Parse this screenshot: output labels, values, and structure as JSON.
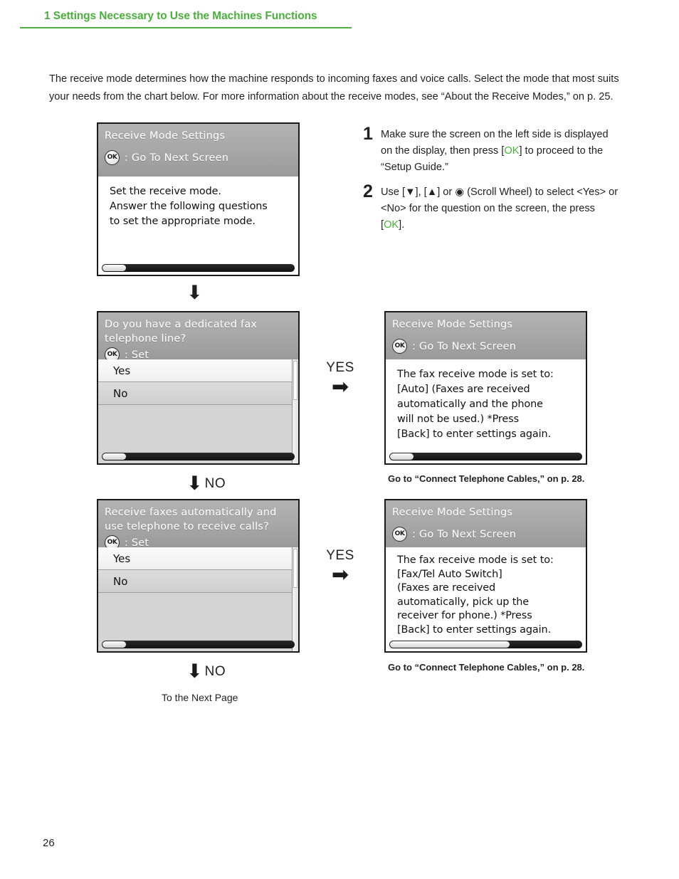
{
  "header": {
    "chapter_title": "1 Settings Necessary to Use the Machines Functions",
    "rule_color": "#4caf3f",
    "title_color": "#4caf3f"
  },
  "intro": {
    "paragraph": "The receive mode determines how the machine responds to incoming faxes and voice calls. Select the mode that most suits your needs from the chart below. For more information about the receive modes, see “About the Receive Modes,” on p. 25."
  },
  "screens": {
    "intro_screen": {
      "title": "Receive Mode Settings",
      "ok_icon": "ok-button-icon",
      "ok_label": ": Go To Next Screen",
      "body": "Set the receive mode.\nAnswer the following questions\nto set the appropriate mode.",
      "hscroll_percent": 12
    },
    "question_one": {
      "title": "Do you have a dedicated fax\ntelephone line?",
      "ok_icon": "ok-button-icon",
      "ok_label": ": Set",
      "options": [
        {
          "label": "Yes",
          "selected": true
        },
        {
          "label": "No",
          "selected": false
        }
      ],
      "hscroll_percent": 12
    },
    "result_auto": {
      "title": "Receive Mode Settings",
      "ok_icon": "ok-button-icon",
      "ok_label": ": Go To Next Screen",
      "body": "The fax receive mode is set to:\n[Auto] (Faxes are received\nautomatically and the phone\nwill not be used.) *Press\n[Back] to enter settings again.",
      "hscroll_percent": 12,
      "caption": "Go to “Connect Telephone Cables,” on p. 28."
    },
    "question_two": {
      "title": "Receive faxes automatically and\nuse telephone to receive calls?",
      "ok_icon": "ok-button-icon",
      "ok_label": ": Set",
      "options": [
        {
          "label": "Yes",
          "selected": true
        },
        {
          "label": "No",
          "selected": false
        }
      ],
      "hscroll_percent": 12
    },
    "result_faxtel": {
      "title": "Receive Mode Settings",
      "ok_icon": "ok-button-icon",
      "ok_label": ": Go To Next Screen",
      "body": "The fax receive mode is set to:\n[Fax/Tel Auto Switch]\n(Faxes are received\nautomatically, pick up the\nreceiver for phone.) *Press\n[Back] to enter settings again.",
      "hscroll_percent": 62,
      "caption": "Go to “Connect Telephone Cables,” on p. 28."
    }
  },
  "steps": [
    {
      "number": "1",
      "parts": [
        {
          "text": "Make sure the screen on the left side is displayed on the display, then press [",
          "kw": false
        },
        {
          "text": "OK",
          "kw": true
        },
        {
          "text": "] to proceed to the “Setup Guide.”",
          "kw": false
        }
      ],
      "plain": "Make sure the screen on the left side is displayed on the display, then press [OK] to proceed to the “Setup Guide.”"
    },
    {
      "number": "2",
      "parts": [
        {
          "text": "Use [▼], [▲] or ◎ (Scroll Wheel) to select <Yes> or <No> for the question on the screen, the press [",
          "kw": false
        },
        {
          "text": "OK",
          "kw": true
        },
        {
          "text": "].",
          "kw": false
        }
      ],
      "plain": "Use [▼], [▲] or ◎ (Scroll Wheel) to select <Yes> or <No> for the question on the screen, the press [OK]."
    }
  ],
  "flow": {
    "arrow_down_glyph": "⬇",
    "arrow_right_glyph": "➡",
    "yes_label_one": "YES",
    "yes_label_two": "YES",
    "no_label_one": "NO",
    "no_label_two": "NO",
    "next_page_note": "To the Next Page"
  },
  "footer": {
    "page_number": "26"
  }
}
